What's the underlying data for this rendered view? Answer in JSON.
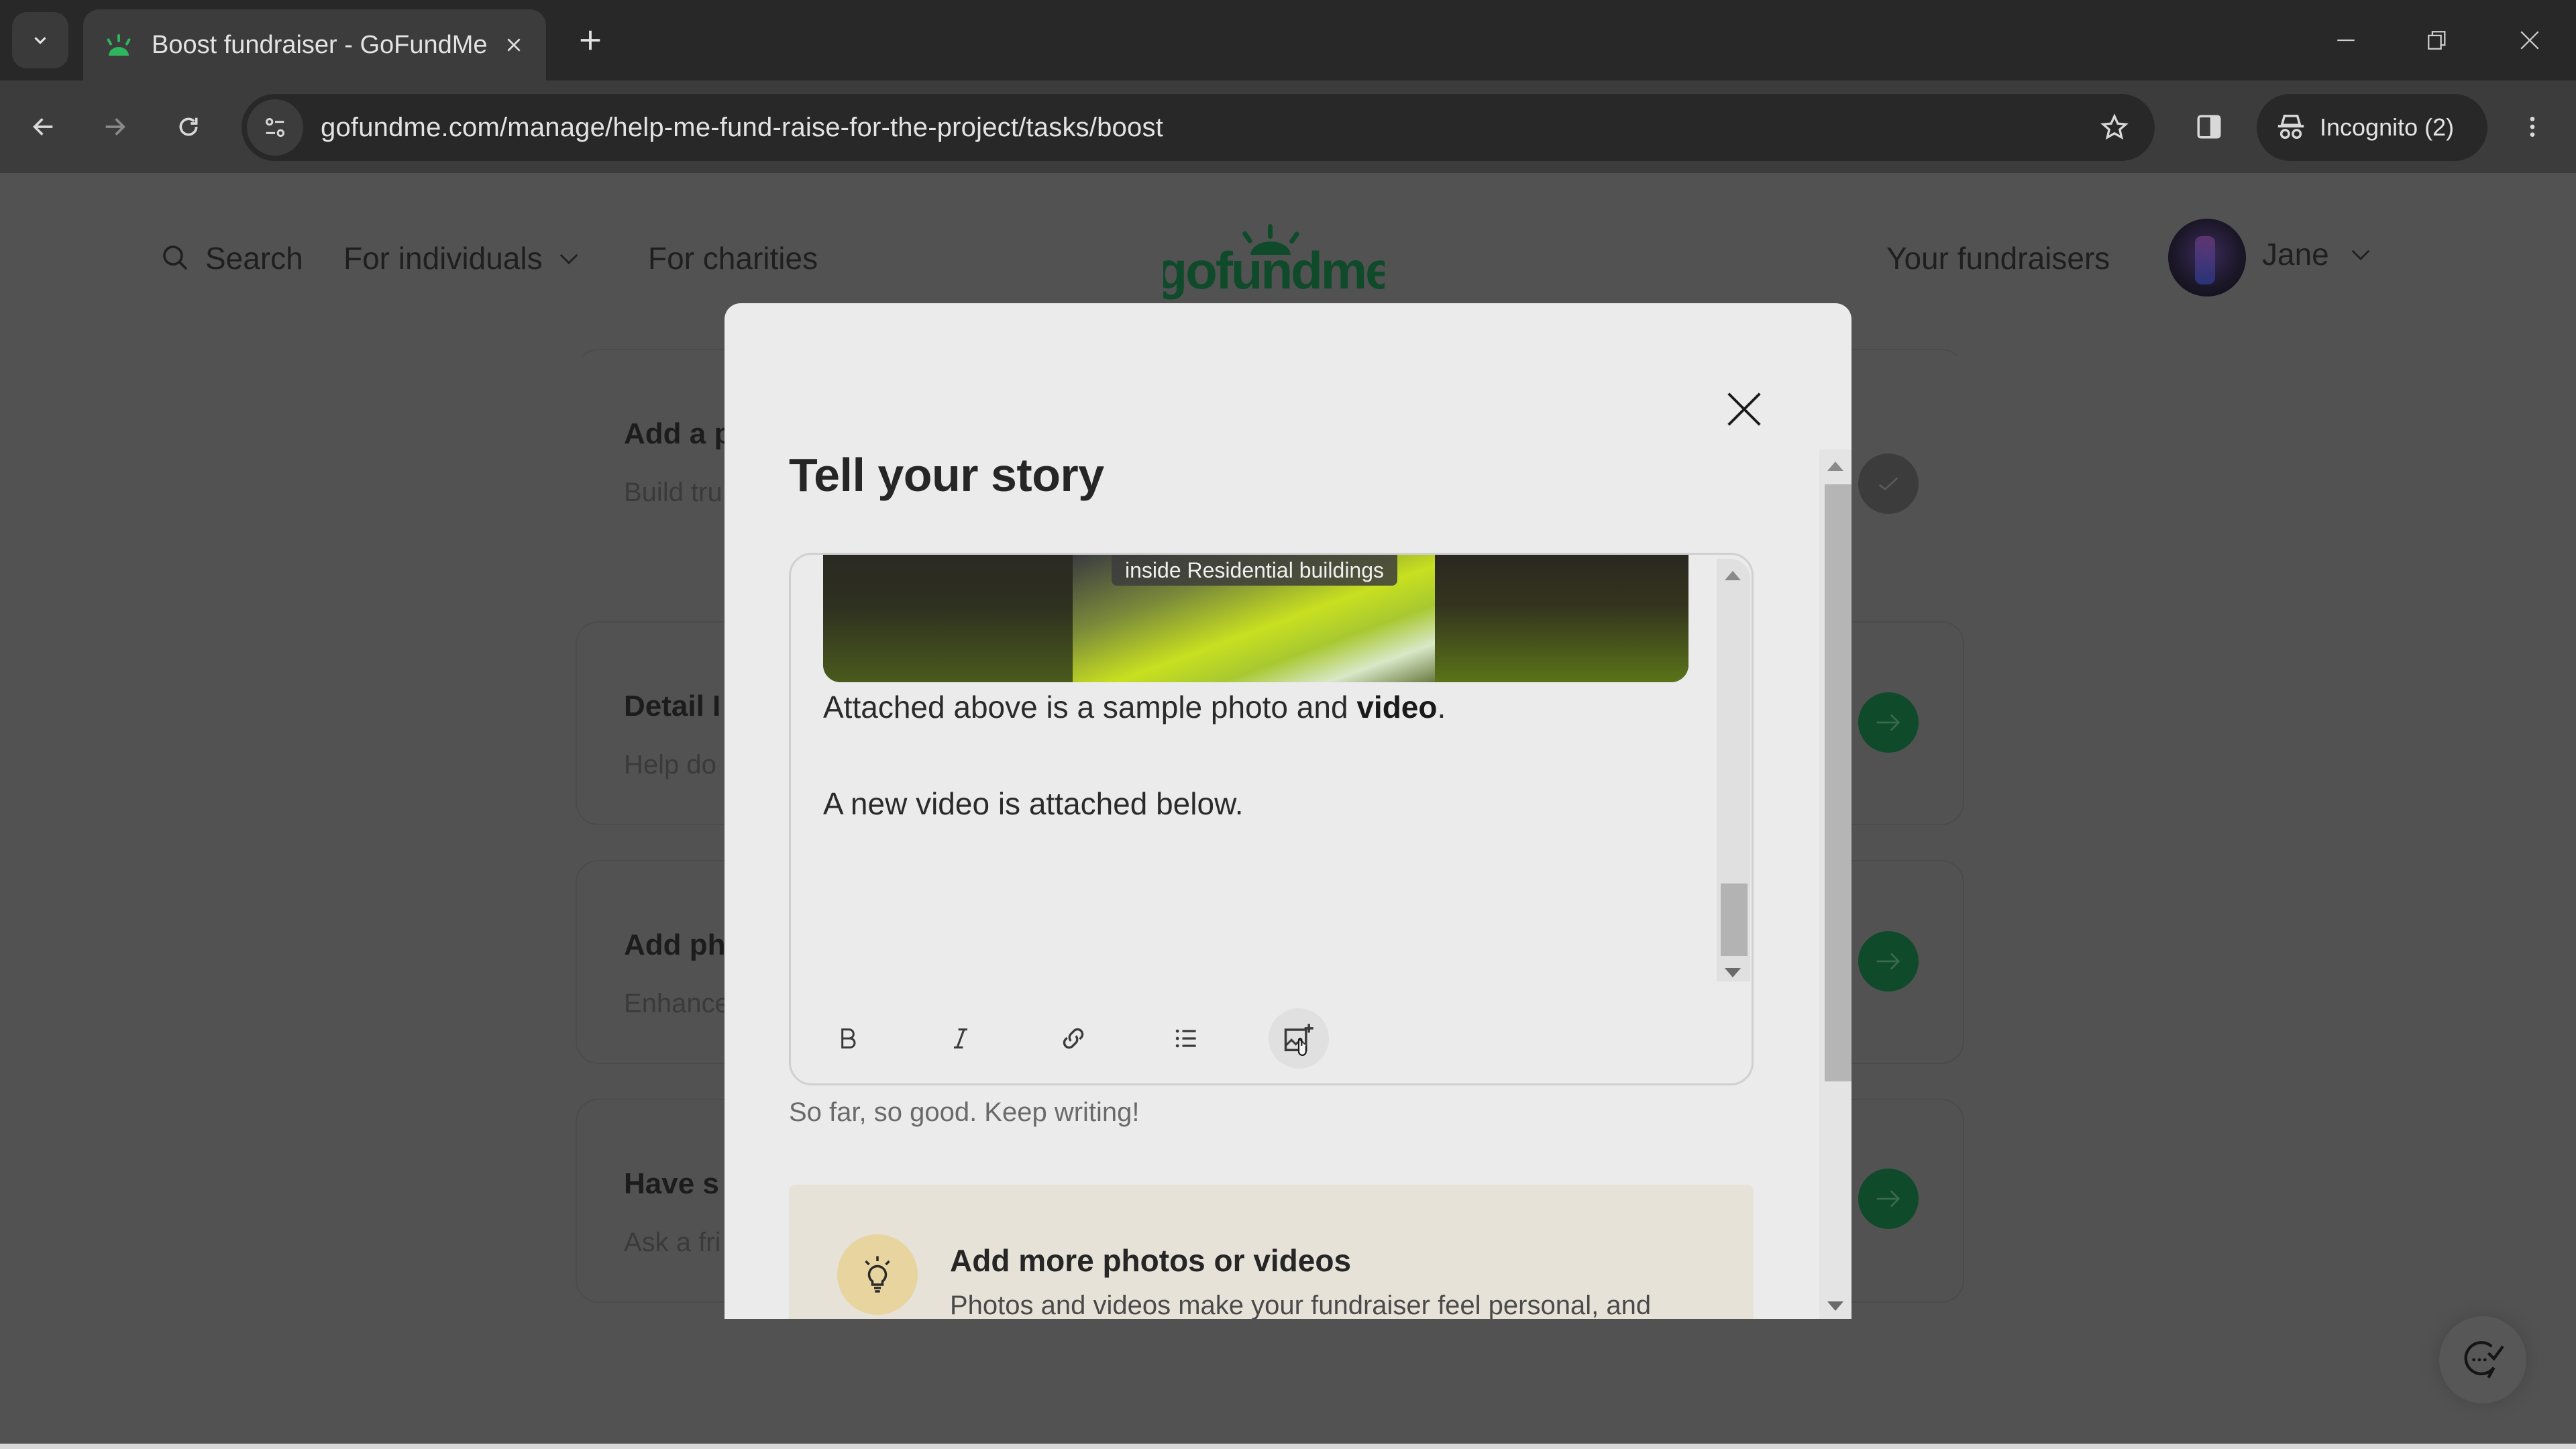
{
  "browser": {
    "tab": {
      "title": "Boost fundraiser - GoFundMe",
      "favicon": "gofundme-sprout-icon"
    },
    "new_tab_label": "+",
    "url": "gofundme.com/manage/help-me-fund-raise-for-the-project/tasks/boost",
    "profile_label": "Incognito (2)",
    "icons": {
      "tab_search": "chevron-down-icon",
      "back": "arrow-left-icon",
      "forward": "arrow-right-icon",
      "reload": "reload-icon",
      "site_info": "tune-icon",
      "bookmark": "star-icon",
      "side_panel": "side-panel-icon",
      "incognito": "incognito-icon",
      "menu": "kebab-menu-icon",
      "minimize": "minimize-icon",
      "restore": "restore-icon",
      "close": "close-icon"
    }
  },
  "site_header": {
    "search_label": "Search",
    "nav": [
      {
        "label": "For individuals",
        "has_dropdown": true
      },
      {
        "label": "For charities",
        "has_dropdown": false
      }
    ],
    "logo_text": "gofundme",
    "your_fundraisers_label": "Your fundraisers",
    "user_name": "Jane",
    "brand_color": "#00b964"
  },
  "task_cards": [
    {
      "title": "Add a p",
      "subtitle": "Build tru",
      "status": "done"
    },
    {
      "title": "Detail I",
      "subtitle": "Help do",
      "status": "todo"
    },
    {
      "title": "Add ph",
      "subtitle": "Enhance",
      "status": "todo"
    },
    {
      "title": "Have s",
      "subtitle": "Ask a fri",
      "status": "todo"
    }
  ],
  "modal": {
    "title": "Tell your story",
    "editor": {
      "video_caption": "inside Residential buildings",
      "paragraph_1_plain": "Attached above is a sample photo and ",
      "paragraph_1_bold": "video",
      "paragraph_1_end": ".",
      "paragraph_2": "A new video is attached below.",
      "toolbar": [
        {
          "name": "bold",
          "icon": "bold-icon",
          "glyph": "B"
        },
        {
          "name": "italic",
          "icon": "italic-icon",
          "glyph": "I"
        },
        {
          "name": "link",
          "icon": "link-icon"
        },
        {
          "name": "bulleted-list",
          "icon": "list-icon"
        },
        {
          "name": "insert-media",
          "icon": "add-media-icon",
          "hovered": true
        }
      ]
    },
    "helper_text": "So far, so good. Keep writing!",
    "tip": {
      "title": "Add more photos or videos",
      "body": "Photos and videos make your fundraiser feel personal, and",
      "icon": "lightbulb-icon"
    }
  },
  "floating_button": {
    "icon": "chat-check-icon"
  }
}
